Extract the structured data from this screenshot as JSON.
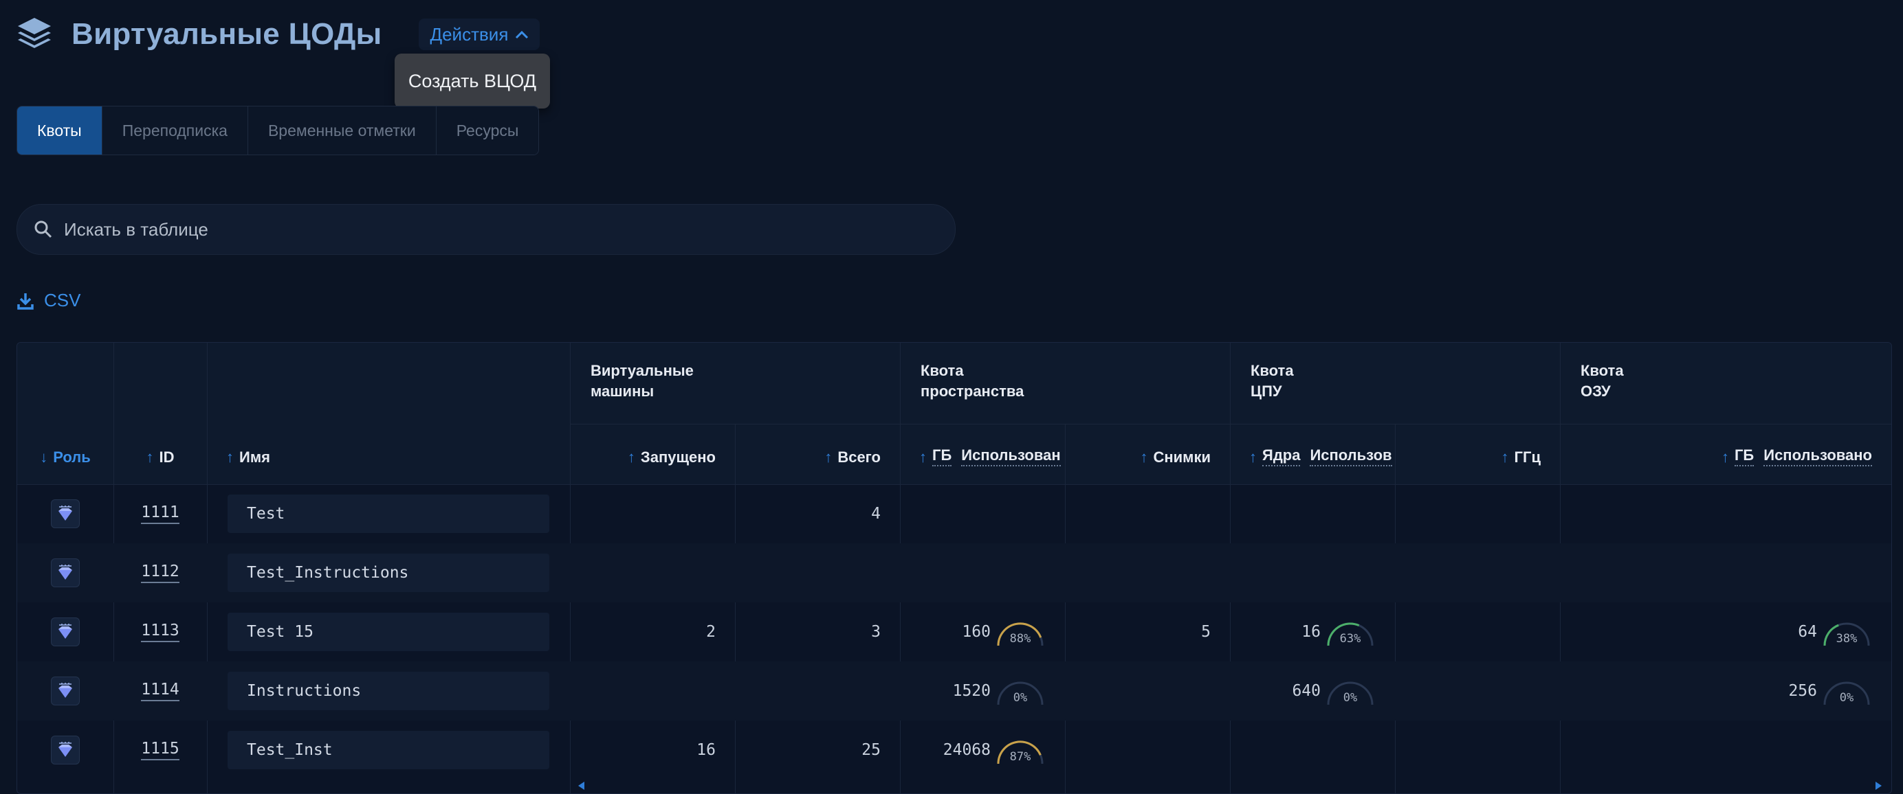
{
  "app": {
    "title": "Виртуальные ЦОДы",
    "actions_label": "Действия",
    "dropdown_item": "Создать ВЦОД"
  },
  "tabs": [
    {
      "label": "Квоты",
      "active": true
    },
    {
      "label": "Переподписка",
      "active": false
    },
    {
      "label": "Временные отметки",
      "active": false
    },
    {
      "label": "Ресурсы",
      "active": false
    }
  ],
  "search": {
    "placeholder": "Искать в таблице",
    "icon": "search-icon"
  },
  "csv_label": "CSV",
  "colors": {
    "accent": "#3b8fe8",
    "active_tab": "#154f8f",
    "gauge_yellow": "#c9a24a",
    "gauge_green": "#4caf6a",
    "gauge_empty": "#2a3852"
  },
  "table": {
    "col_role": "Роль",
    "col_id": "ID",
    "col_name": "Имя",
    "groups": {
      "vm": "Виртуальные\nмашины",
      "space": "Квота\nпространства",
      "cpu": "Квота\nЦПУ",
      "ram": "Квота\nОЗУ"
    },
    "sub": {
      "running": "Запущено",
      "total": "Всего",
      "space_gb": "ГБ",
      "space_used": "Использован",
      "snapshots": "Снимки",
      "cores": "Ядра",
      "cores_used": "Использов",
      "ghz": "ГГц",
      "ram_gb": "ГБ",
      "ram_used": "Использовано"
    },
    "rows": [
      {
        "id": "1111",
        "name": "Test",
        "running": "",
        "total": "4",
        "space_gb": "",
        "space_pct": null,
        "snapshots": "",
        "cores": "",
        "cores_pct": null,
        "ram_gb": "",
        "ram_pct": null
      },
      {
        "id": "1112",
        "name": "Test_Instructions",
        "running": "",
        "total": "",
        "space_gb": "",
        "space_pct": null,
        "snapshots": "",
        "cores": "",
        "cores_pct": null,
        "ram_gb": "",
        "ram_pct": null
      },
      {
        "id": "1113",
        "name": "Test 15",
        "running": "2",
        "total": "3",
        "space_gb": "160",
        "space_pct": 88,
        "snapshots": "5",
        "cores": "16",
        "cores_pct": 63,
        "ram_gb": "64",
        "ram_pct": 38
      },
      {
        "id": "1114",
        "name": "Instructions",
        "running": "",
        "total": "",
        "space_gb": "1520",
        "space_pct": 0,
        "snapshots": "",
        "cores": "640",
        "cores_pct": 0,
        "ram_gb": "256",
        "ram_pct": 0
      },
      {
        "id": "1115",
        "name": "Test_Inst",
        "running": "16",
        "total": "25",
        "space_gb": "24068",
        "space_pct": 87,
        "snapshots": "",
        "cores": "",
        "cores_pct": null,
        "ram_gb": "",
        "ram_pct": null
      }
    ]
  }
}
